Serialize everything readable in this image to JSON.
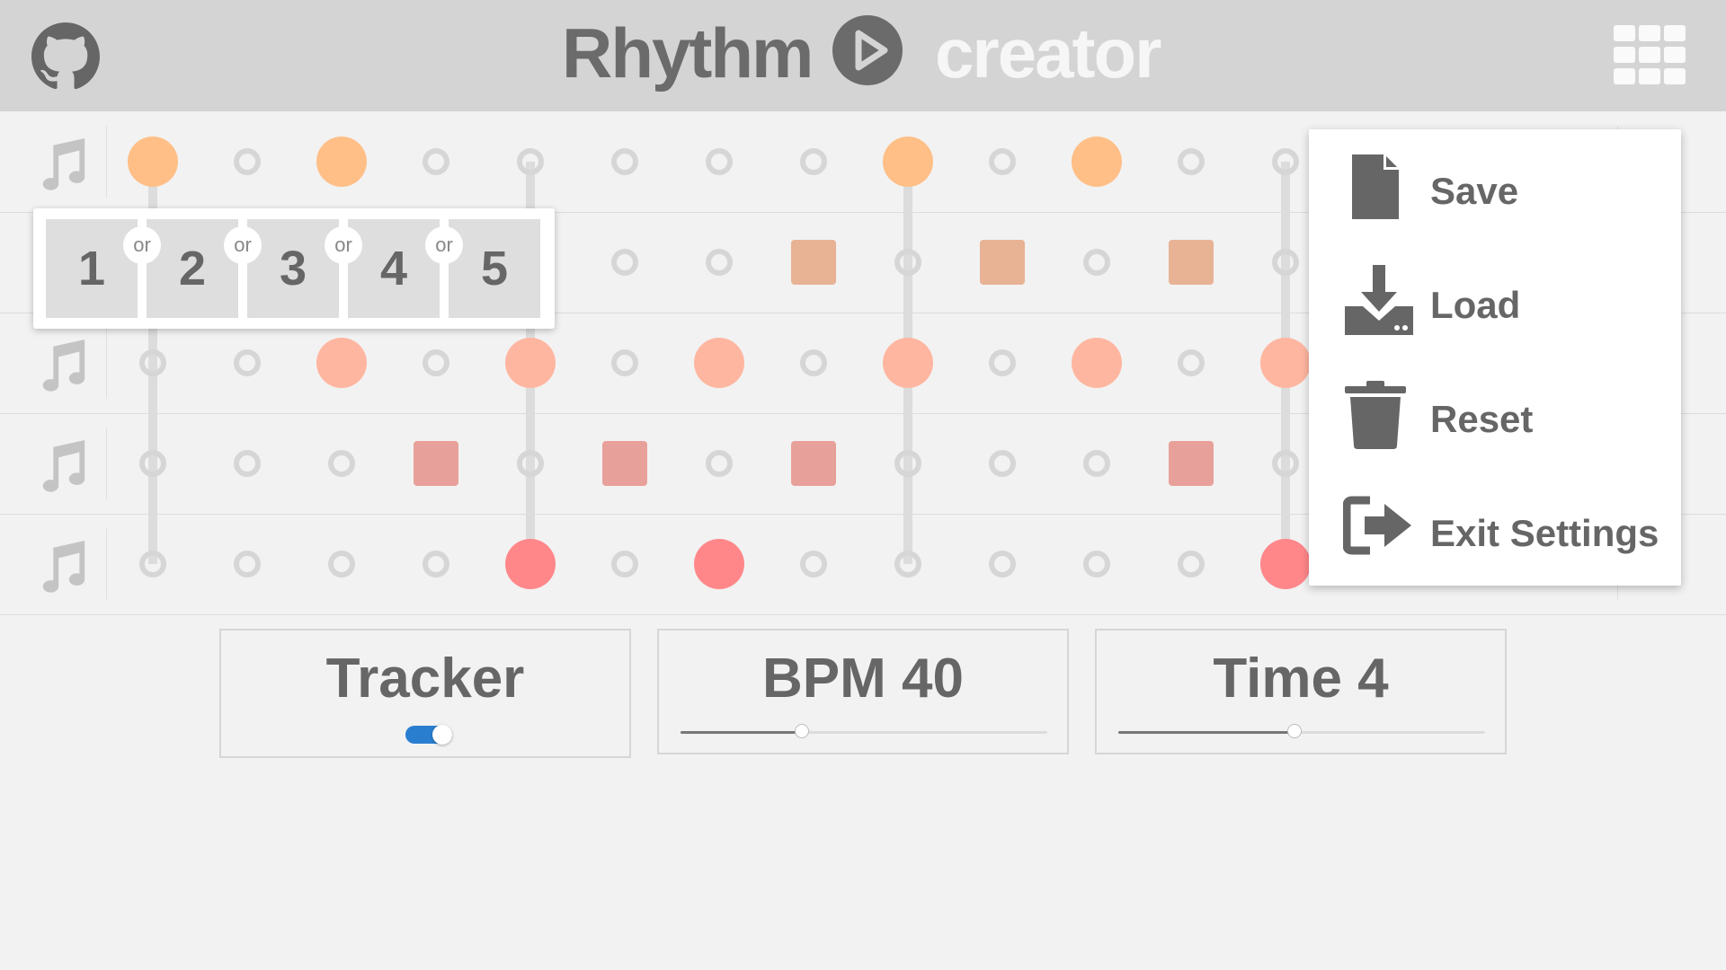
{
  "header": {
    "title_part1": "Rhythm",
    "title_part2": "creator",
    "github_icon": "github-icon",
    "play_icon": "play-icon",
    "menu_icon": "grid-menu-icon",
    "background": "#d4d4d4"
  },
  "grid": {
    "rows": [
      {
        "instrument_icon": "music-note-icon",
        "color": "#ffbf87",
        "shape": "circle",
        "active": [
          0,
          2,
          8,
          10
        ]
      },
      {
        "instrument_icon": "music-note-icon",
        "color": "#e8b295",
        "shape": "square",
        "active": [
          7,
          9,
          11
        ]
      },
      {
        "instrument_icon": "music-note-icon",
        "color": "#ffb6a0",
        "shape": "circle",
        "active": [
          2,
          4,
          6,
          8,
          10,
          12
        ]
      },
      {
        "instrument_icon": "music-note-icon",
        "color": "#e8a19a",
        "shape": "square",
        "active": [
          3,
          5,
          7,
          11
        ]
      },
      {
        "instrument_icon": "music-note-icon",
        "color": "#ff878a",
        "shape": "circle",
        "active": [
          4,
          6,
          12
        ]
      }
    ],
    "beat_lines": [
      0,
      4,
      8,
      12
    ]
  },
  "popup": {
    "options": [
      "1",
      "2",
      "3",
      "4",
      "5"
    ],
    "separator": "or"
  },
  "menu": {
    "items": [
      {
        "label": "Save",
        "icon": "file-icon"
      },
      {
        "label": "Load",
        "icon": "download-icon"
      },
      {
        "label": "Reset",
        "icon": "trash-icon"
      },
      {
        "label": "Exit Settings",
        "icon": "exit-icon"
      }
    ]
  },
  "controls": {
    "tracker_label": "Tracker",
    "tracker_on": true,
    "bpm_label": "BPM 40",
    "bpm_fraction": 0.33,
    "time_label": "Time 4",
    "time_fraction": 0.48,
    "accent": "#2a7ed0"
  }
}
